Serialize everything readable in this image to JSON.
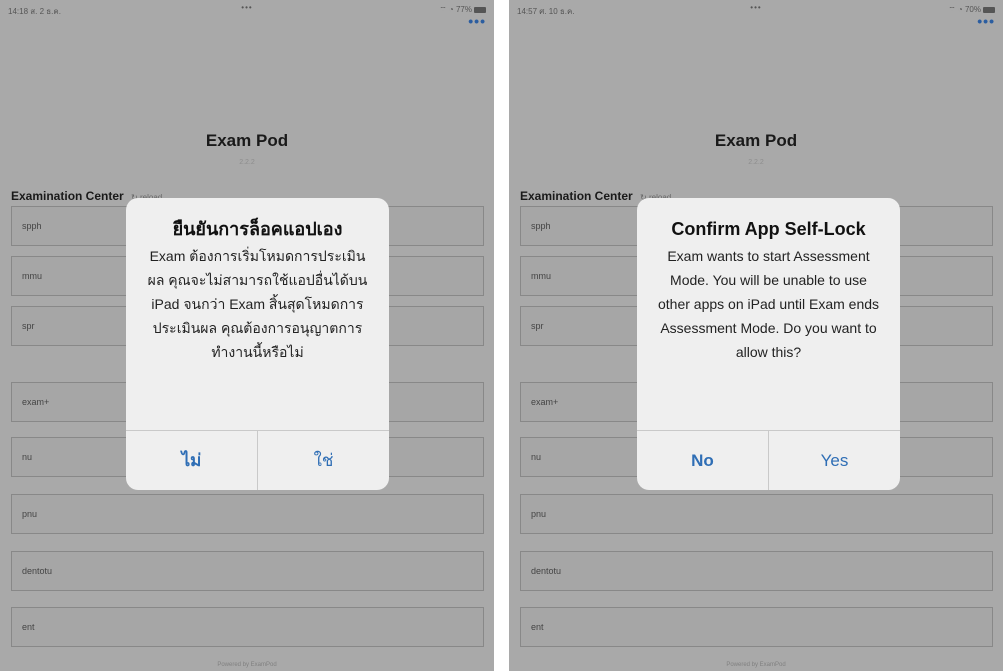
{
  "screens": [
    {
      "status": {
        "time": "14:18 ส. 2 ธ.ค.",
        "center": "•••",
        "right": "⌔ ◔ 77%"
      },
      "more_icon": "•••",
      "app_title": "Exam Pod",
      "app_subtitle": "2.2.2",
      "section_header": "Examination Center",
      "reload_label": "↻ reload",
      "list_items": [
        "spph",
        "mmu",
        "spr",
        "exam+",
        "nu",
        "pnu",
        "dentotu",
        "ent"
      ],
      "footer": "Powered by ExamPod",
      "dialog": {
        "title": "ยืนยันการล็อคแอปเอง",
        "message": "Exam ต้องการเริ่มโหมดการประเมินผล คุณจะไม่สามารถใช้แอปอื่นได้บน iPad จนกว่า Exam สิ้นสุดโหมดการประเมินผล คุณต้องการอนุญาตการทำงานนี้หรือไม่",
        "no_label": "ไม่",
        "yes_label": "ใช่"
      }
    },
    {
      "status": {
        "time": "14:57 ศ. 10 ธ.ค.",
        "center": "•••",
        "right": "⌔ ◔ 70%"
      },
      "more_icon": "•••",
      "app_title": "Exam Pod",
      "app_subtitle": "2.2.2",
      "section_header": "Examination Center",
      "reload_label": "↻ reload",
      "list_items": [
        "spph",
        "mmu",
        "spr",
        "exam+",
        "nu",
        "pnu",
        "dentotu",
        "ent"
      ],
      "footer": "Powered by ExamPod",
      "dialog": {
        "title": "Confirm App Self-Lock",
        "message": "Exam wants to start Assessment Mode. You will be unable to use other apps on iPad until Exam ends Assessment Mode. Do you want to allow this?",
        "no_label": "No",
        "yes_label": "Yes"
      }
    }
  ],
  "colors": {
    "dim_background": "#a9a9a9",
    "dialog_background": "#efefef",
    "accent_blue": "#2f6eb5"
  }
}
